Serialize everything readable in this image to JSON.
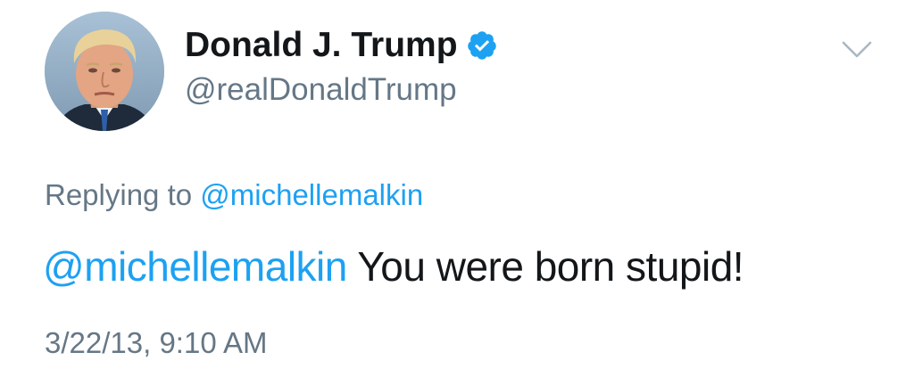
{
  "tweet": {
    "author": {
      "display_name": "Donald J. Trump",
      "handle": "@realDonaldTrump",
      "verified_icon": "verified-badge-icon",
      "avatar_icon": "profile-photo"
    },
    "menu_icon": "chevron-down-icon",
    "reply_context": {
      "prefix": "Replying to",
      "mention": "@michellemalkin"
    },
    "text": {
      "mention": "@michellemalkin",
      "body": "You were born stupid!"
    },
    "timestamp": "3/22/13, 9:10 AM"
  },
  "colors": {
    "link": "#1da1f2",
    "secondary_text": "#657786",
    "primary_text": "#14171a",
    "verified_badge": "#1da1f2",
    "chevron": "#aab8c2"
  }
}
